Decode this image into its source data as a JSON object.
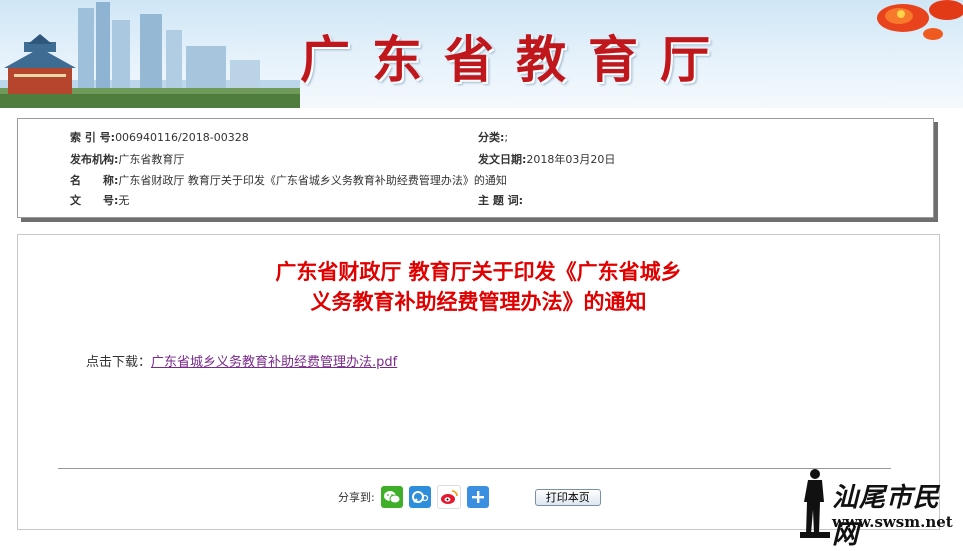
{
  "banner": {
    "title": "广东省教育厅"
  },
  "info": {
    "index_label": "索 引 号:",
    "index_value": "006940116/2018-00328",
    "category_label": "分类:",
    "category_value": ";",
    "publisher_label": "发布机构:",
    "publisher_value": "广东省教育厅",
    "date_label": "发文日期:",
    "date_value": "2018年03月20日",
    "name_label": "名　　称:",
    "name_value": "广东省财政厅  教育厅关于印发《广东省城乡义务教育补助经费管理办法》的通知",
    "docno_label": "文　　号:",
    "docno_value": "无",
    "keywords_label": "主 题 词:",
    "keywords_value": ""
  },
  "content": {
    "title_line1": "广东省财政厅  教育厅关于印发《广东省城乡",
    "title_line2": "义务教育补助经费管理办法》的通知",
    "download_label": "点击下载：",
    "download_link": "广东省城乡义务教育补助经费管理办法.pdf"
  },
  "share": {
    "label": "分享到:",
    "icons": [
      "wechat-icon",
      "qq-zone-icon",
      "weibo-icon",
      "more-share-icon"
    ],
    "print_label": "打印本页"
  },
  "watermark": {
    "text": "汕尾市民网",
    "url": "www.swsm.net"
  },
  "colors": {
    "title_red": "#e00000",
    "banner_red": "#c0171d",
    "link_purple": "#7a2a8a"
  }
}
